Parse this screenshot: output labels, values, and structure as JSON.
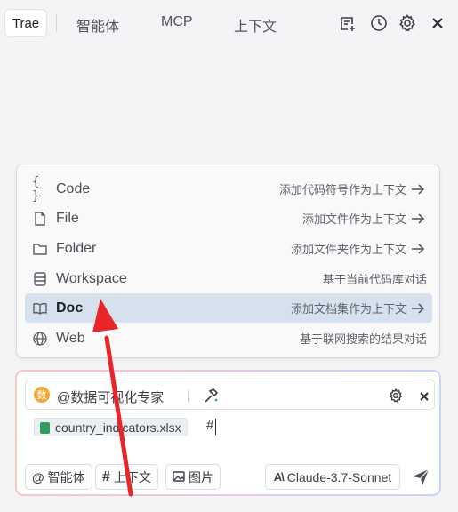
{
  "topbar": {
    "tabs": [
      {
        "label": "Trae"
      },
      {
        "label": "智能体"
      },
      {
        "label": "MCP"
      },
      {
        "label": "上下文"
      }
    ],
    "icons": [
      "new-chat-icon",
      "history-icon",
      "gear-icon",
      "close-icon"
    ]
  },
  "context_menu": {
    "items": [
      {
        "label": "Code",
        "description": "添加代码符号作为上下文",
        "icon": "braces-icon",
        "has_arrow": true
      },
      {
        "label": "File",
        "description": "添加文件作为上下文",
        "icon": "file-icon",
        "has_arrow": true
      },
      {
        "label": "Folder",
        "description": "添加文件夹作为上下文",
        "icon": "folder-icon",
        "has_arrow": true
      },
      {
        "label": "Workspace",
        "description": "基于当前代码库对话",
        "icon": "workspace-icon",
        "has_arrow": false
      },
      {
        "label": "Doc",
        "description": "添加文档集作为上下文",
        "icon": "book-icon",
        "has_arrow": true,
        "selected": true
      },
      {
        "label": "Web",
        "description": "基于联网搜索的结果对话",
        "icon": "globe-icon",
        "has_arrow": false
      }
    ]
  },
  "input": {
    "agent_badge": "数",
    "agent_name": "@数据可视化专家",
    "attachment": "country_indicators.xlsx",
    "typed_text": "#",
    "buttons": {
      "agent": "智能体",
      "context": "上下文",
      "image": "图片",
      "model": "Claude-3.7-Sonnet"
    }
  },
  "colors": {
    "selected_row": "#d5e2ee",
    "annotation_arrow": "#e8262a",
    "agent_badge": "#f3a73b",
    "excel_icon": "#2e9d5a"
  }
}
